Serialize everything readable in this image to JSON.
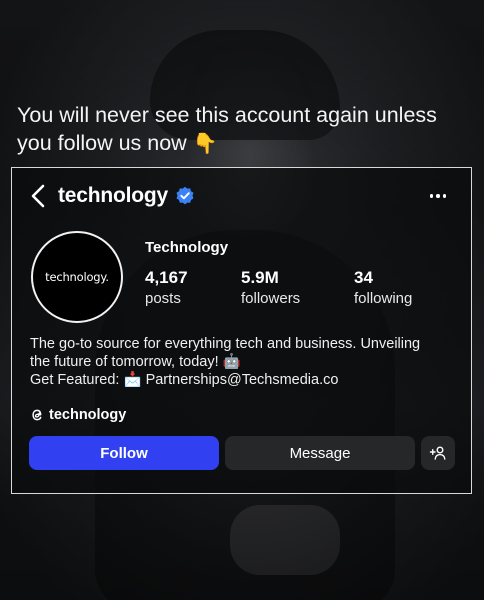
{
  "headline": {
    "text": "You will never see this account again unless you follow us now",
    "emoji": "👇"
  },
  "profile": {
    "handle": "technology",
    "display_name": "Technology",
    "avatar_text": "technology.",
    "stats": {
      "posts": {
        "value": "4,167",
        "label": "posts"
      },
      "followers": {
        "value": "5.9M",
        "label": "followers"
      },
      "following": {
        "value": "34",
        "label": "following"
      }
    },
    "bio": {
      "line1": "The go-to source for everything tech and business. Unveiling",
      "line2": "the future of tomorrow, today! 🤖",
      "line3": "Get Featured: 📩 Partnerships@Techsmedia.co"
    },
    "threads_handle": "technology"
  },
  "actions": {
    "follow_label": "Follow",
    "message_label": "Message"
  },
  "colors": {
    "follow_button": "#3140f0",
    "verified_badge": "#3b82f6",
    "secondary_button": "#262728"
  }
}
